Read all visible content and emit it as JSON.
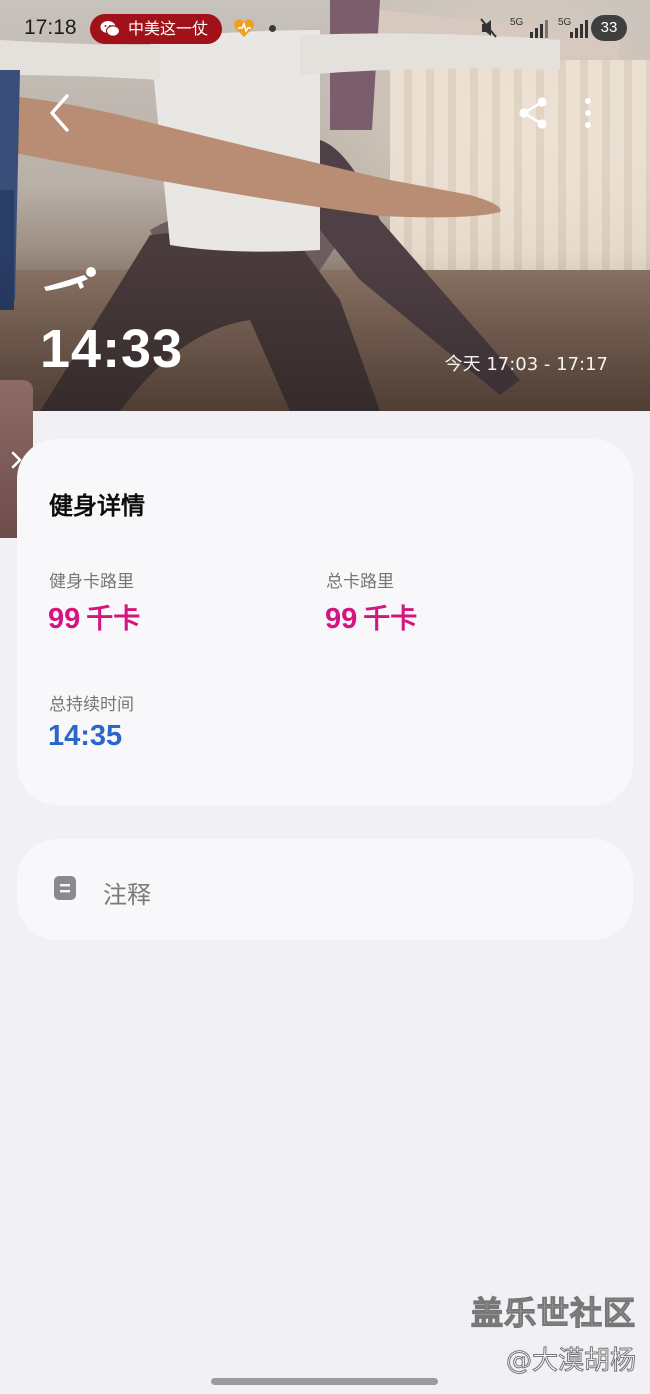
{
  "status_bar": {
    "time": "17:18",
    "notification_text": "中美这一仗",
    "network_1": "5G",
    "network_2": "5G",
    "battery": "33"
  },
  "hero": {
    "duration": "14:33",
    "time_range": "今天 17:03 - 17:17",
    "activity_icon": "push-up-icon"
  },
  "details": {
    "title": "健身详情",
    "fitness_calories_label": "健身卡路里",
    "fitness_calories_value": "99",
    "fitness_calories_unit": "千卡",
    "total_calories_label": "总卡路里",
    "total_calories_value": "99",
    "total_calories_unit": "千卡",
    "total_duration_label": "总持续时间",
    "total_duration_value": "14:35"
  },
  "notes": {
    "label": "注释"
  },
  "watermark": {
    "line1": "盖乐世社区",
    "line2": "@大漠胡杨"
  },
  "colors": {
    "calories": "#d4157f",
    "duration": "#2b67c8",
    "background": "#f1f0f5",
    "card": "#f8f8fb"
  }
}
